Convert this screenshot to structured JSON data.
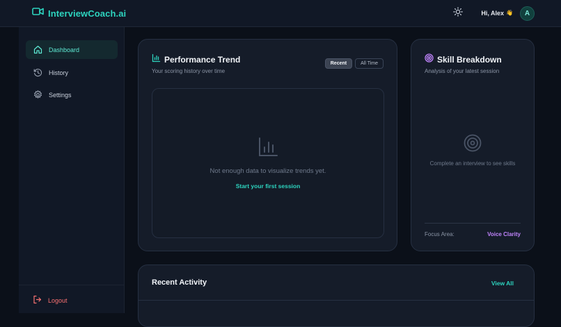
{
  "header": {
    "brand": "InterviewCoach.ai",
    "greeting": "Hi, Alex",
    "wave": "👋",
    "avatar_initial": "A"
  },
  "sidebar": {
    "items": [
      {
        "label": "Dashboard",
        "icon": "home-icon",
        "active": true
      },
      {
        "label": "History",
        "icon": "history-icon",
        "active": false
      },
      {
        "label": "Settings",
        "icon": "gear-icon",
        "active": false
      }
    ],
    "logout": "Logout"
  },
  "performance": {
    "title": "Performance Trend",
    "subtitle": "Your scoring history over time",
    "tabs": [
      "Recent",
      "All Time"
    ],
    "selected_tab": "Recent",
    "empty_message": "Not enough data to visualize trends yet.",
    "cta": "Start your first session"
  },
  "skills": {
    "title": "Skill Breakdown",
    "subtitle": "Analysis of your latest session",
    "empty_message": "Complete an interview to see skills",
    "focus_label": "Focus Area:",
    "focus_value": "Voice Clarity"
  },
  "recent": {
    "title": "Recent Activity",
    "view_all": "View All"
  },
  "colors": {
    "accent": "#2dd4bf",
    "purple": "#c084fc",
    "danger": "#f87171",
    "background": "#0b1019",
    "card": "#151c29"
  }
}
